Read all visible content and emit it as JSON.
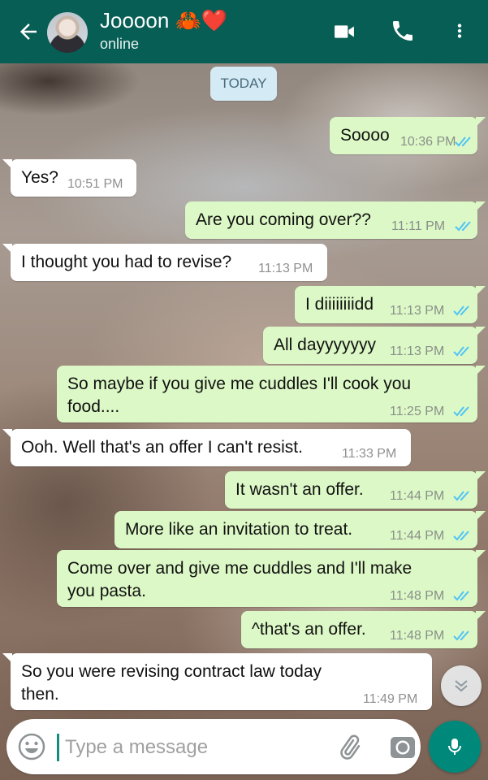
{
  "header": {
    "contact_name": "Joooon 🦀❤️",
    "status": "online",
    "icons": [
      "back-arrow",
      "video-call",
      "voice-call",
      "more-options"
    ],
    "color": "#075e54"
  },
  "date_chip": "TODAY",
  "messages": [
    {
      "dir": "out",
      "text": "Soooo",
      "time": "10:36 PM",
      "read": true
    },
    {
      "dir": "in",
      "text": "Yes?",
      "time": "10:51 PM"
    },
    {
      "dir": "out",
      "text": "Are you coming over??",
      "time": "11:11 PM",
      "read": true
    },
    {
      "dir": "in",
      "text": "I thought you had to revise?",
      "time": "11:13 PM"
    },
    {
      "dir": "out",
      "text": "I diiiiiiiidd",
      "time": "11:13 PM",
      "read": true
    },
    {
      "dir": "out",
      "text": "All dayyyyyyy",
      "time": "11:13 PM",
      "read": true
    },
    {
      "dir": "out",
      "text": "So maybe if you give me cuddles I'll cook you\nfood....",
      "time": "11:25 PM",
      "read": true
    },
    {
      "dir": "in",
      "text": "Ooh. Well that's an offer I can't resist.",
      "time": "11:33 PM"
    },
    {
      "dir": "out",
      "text": "It wasn't an offer.",
      "time": "11:44 PM",
      "read": true
    },
    {
      "dir": "out",
      "text": "More like an invitation to treat.",
      "time": "11:44 PM",
      "read": true
    },
    {
      "dir": "out",
      "text": "Come over and give me cuddles and I'll make\nyou pasta.",
      "time": "11:48 PM",
      "read": true
    },
    {
      "dir": "out",
      "text": "^that's an offer.",
      "time": "11:48 PM",
      "read": true
    },
    {
      "dir": "in",
      "text": "So you were revising contract law today\nthen.",
      "time": "11:49 PM"
    }
  ],
  "composer": {
    "placeholder": "Type a message",
    "value": "",
    "icons": [
      "emoji",
      "attach",
      "camera",
      "mic"
    ]
  },
  "colors": {
    "outgoing_bubble": "#dcf8c6",
    "incoming_bubble": "#ffffff",
    "read_ticks": "#4fc3f7",
    "accent": "#00897b"
  }
}
